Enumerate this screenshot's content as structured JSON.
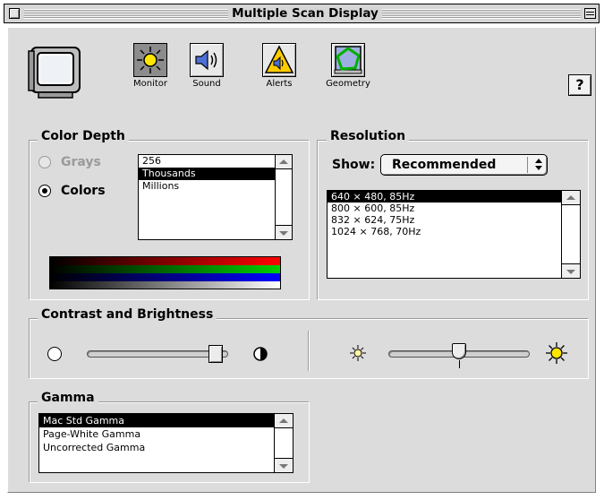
{
  "window": {
    "title": "Multiple Scan Display"
  },
  "toolbar": {
    "items": [
      {
        "label": "Monitor",
        "icon": "sun-icon",
        "selected": true
      },
      {
        "label": "Sound",
        "icon": "speaker-icon",
        "selected": false
      },
      {
        "label": "Alerts",
        "icon": "alert-speaker-icon",
        "selected": false
      },
      {
        "label": "Geometry",
        "icon": "geometry-icon",
        "selected": false
      }
    ],
    "help_label": "?"
  },
  "color_depth": {
    "title": "Color Depth",
    "grays_label": "Grays",
    "colors_label": "Colors",
    "selected_mode": "Colors",
    "options": [
      "256",
      "Thousands",
      "Millions"
    ],
    "selected_option": "Thousands"
  },
  "resolution": {
    "title": "Resolution",
    "show_label": "Show:",
    "show_value": "Recommended",
    "options": [
      "640 × 480, 85Hz",
      "800 × 600, 85Hz",
      "832 × 624, 75Hz",
      "1024 × 768, 70Hz"
    ],
    "selected_option": "640 × 480, 85Hz"
  },
  "contrast_brightness": {
    "title": "Contrast and Brightness",
    "contrast_level": 0.9,
    "brightness_level": 0.5
  },
  "gamma": {
    "title": "Gamma",
    "options": [
      "Mac Std Gamma",
      "Page-White Gamma",
      "Uncorrected Gamma"
    ],
    "selected_option": "Mac Std Gamma"
  },
  "colors": {
    "chrome": "#dcdcdc",
    "selection": "#000000",
    "sun_yellow": "#ffe600",
    "alert_yellow": "#ffcc00",
    "geometry_green": "#00b000"
  }
}
